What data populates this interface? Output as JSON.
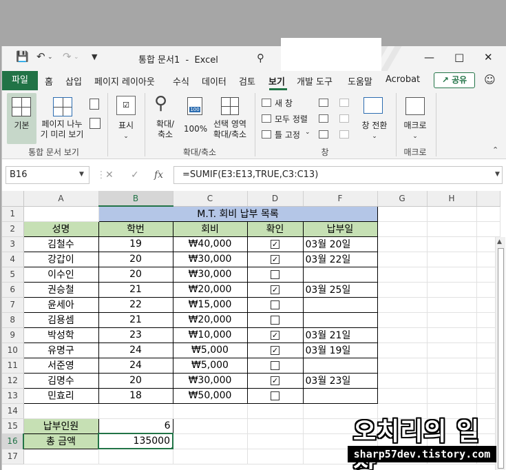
{
  "window": {
    "doc_title": "통합 문서1  -  Excel",
    "share_label": "공유"
  },
  "tabs": [
    "파일",
    "홈",
    "삽입",
    "페이지 레이아웃",
    "수식",
    "데이터",
    "검토",
    "보기",
    "개발 도구",
    "도움말",
    "Acrobat"
  ],
  "active_tab": "보기",
  "ribbon": {
    "normal": "기본",
    "page_break": "페이지 나누\n기 미리 보기",
    "group_workbook_views": "통합 문서 보기",
    "show": "표시",
    "zoom": "확대/\n축소",
    "zoom100": "100%",
    "zoom_selection": "선택 영역\n확대/축소",
    "group_zoom": "확대/축소",
    "new_window": "새 창",
    "arrange_all": "모두 정렬",
    "freeze_panes": "틀 고정",
    "switch_windows": "창 전환",
    "group_window": "창",
    "macros": "매크로",
    "group_macros": "매크로"
  },
  "formula_bar": {
    "name_box": "B16",
    "formula": "=SUMIF(E3:E13,TRUE,C3:C13)",
    "fx": "fx"
  },
  "sheet": {
    "columns": [
      "A",
      "B",
      "C",
      "D",
      "F",
      "G",
      "H"
    ],
    "title": "M.T. 회비 납부 목록",
    "headers": [
      "성명",
      "학번",
      "회비",
      "확인",
      "납부일"
    ],
    "rows": [
      {
        "name": "김철수",
        "id": "19",
        "fee": "₩40,000",
        "checked": true,
        "date": "03월 20일"
      },
      {
        "name": "강갑이",
        "id": "20",
        "fee": "₩30,000",
        "checked": true,
        "date": "03월 22일"
      },
      {
        "name": "이수인",
        "id": "20",
        "fee": "₩30,000",
        "checked": false,
        "date": ""
      },
      {
        "name": "권승철",
        "id": "21",
        "fee": "₩20,000",
        "checked": true,
        "date": "03월 25일"
      },
      {
        "name": "윤세아",
        "id": "22",
        "fee": "₩15,000",
        "checked": false,
        "date": ""
      },
      {
        "name": "김용셈",
        "id": "21",
        "fee": "₩20,000",
        "checked": false,
        "date": ""
      },
      {
        "name": "박성학",
        "id": "23",
        "fee": "₩10,000",
        "checked": true,
        "date": "03월 21일"
      },
      {
        "name": "유명구",
        "id": "24",
        "fee": "₩5,000",
        "checked": true,
        "date": "03월 19일"
      },
      {
        "name": "서준영",
        "id": "24",
        "fee": "₩5,000",
        "checked": false,
        "date": ""
      },
      {
        "name": "김명수",
        "id": "20",
        "fee": "₩30,000",
        "checked": true,
        "date": "03월 23일"
      },
      {
        "name": "민효리",
        "id": "18",
        "fee": "₩50,000",
        "checked": false,
        "date": ""
      }
    ],
    "summary": [
      {
        "label": "납부인원",
        "value": "6"
      },
      {
        "label": "총 금액",
        "value": "135000"
      }
    ],
    "row_numbers": [
      "1",
      "2",
      "3",
      "4",
      "5",
      "6",
      "7",
      "8",
      "9",
      "10",
      "11",
      "12",
      "13",
      "14",
      "15",
      "16",
      "17"
    ]
  },
  "watermark": {
    "title": "오치리의 일상",
    "url": "sharp57dev.tistory.com"
  },
  "colors": {
    "excel_green": "#217346",
    "header_green": "#c6e0b4",
    "title_blue": "#b4c6e7"
  }
}
